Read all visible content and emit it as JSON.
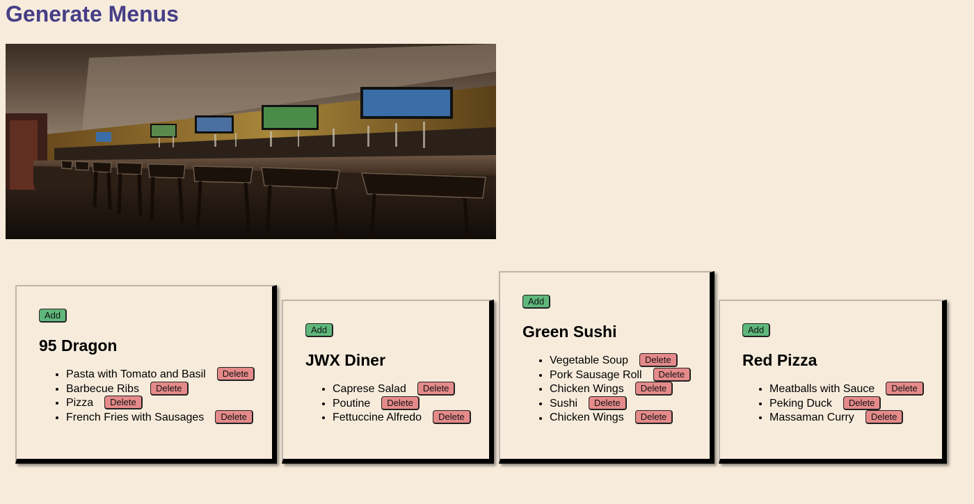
{
  "page": {
    "title": "Generate Menus"
  },
  "colors": {
    "background": "#f7ecdc",
    "title": "#463e86",
    "add_button": "#5fb77c",
    "delete_button": "#e58a8a"
  },
  "banner": {
    "description_icon": "restaurant-bar-photo"
  },
  "menus": [
    {
      "name": "95 Dragon",
      "add_label": "Add",
      "items": [
        {
          "label": "Pasta with Tomato and Basil",
          "delete_label": "Delete"
        },
        {
          "label": "Barbecue Ribs",
          "delete_label": "Delete"
        },
        {
          "label": "Pizza",
          "delete_label": "Delete"
        },
        {
          "label": "French Fries with Sausages",
          "delete_label": "Delete"
        }
      ]
    },
    {
      "name": "JWX Diner",
      "add_label": "Add",
      "items": [
        {
          "label": "Caprese Salad",
          "delete_label": "Delete"
        },
        {
          "label": "Poutine",
          "delete_label": "Delete"
        },
        {
          "label": "Fettuccine Alfredo",
          "delete_label": "Delete"
        }
      ]
    },
    {
      "name": "Green Sushi",
      "add_label": "Add",
      "items": [
        {
          "label": "Vegetable Soup",
          "delete_label": "Delete"
        },
        {
          "label": "Pork Sausage Roll",
          "delete_label": "Delete"
        },
        {
          "label": "Chicken Wings",
          "delete_label": "Delete"
        },
        {
          "label": "Sushi",
          "delete_label": "Delete"
        },
        {
          "label": "Chicken Wings",
          "delete_label": "Delete"
        }
      ]
    },
    {
      "name": "Red Pizza",
      "add_label": "Add",
      "items": [
        {
          "label": "Meatballs with Sauce",
          "delete_label": "Delete"
        },
        {
          "label": "Peking Duck",
          "delete_label": "Delete"
        },
        {
          "label": "Massaman Curry",
          "delete_label": "Delete"
        }
      ]
    }
  ]
}
